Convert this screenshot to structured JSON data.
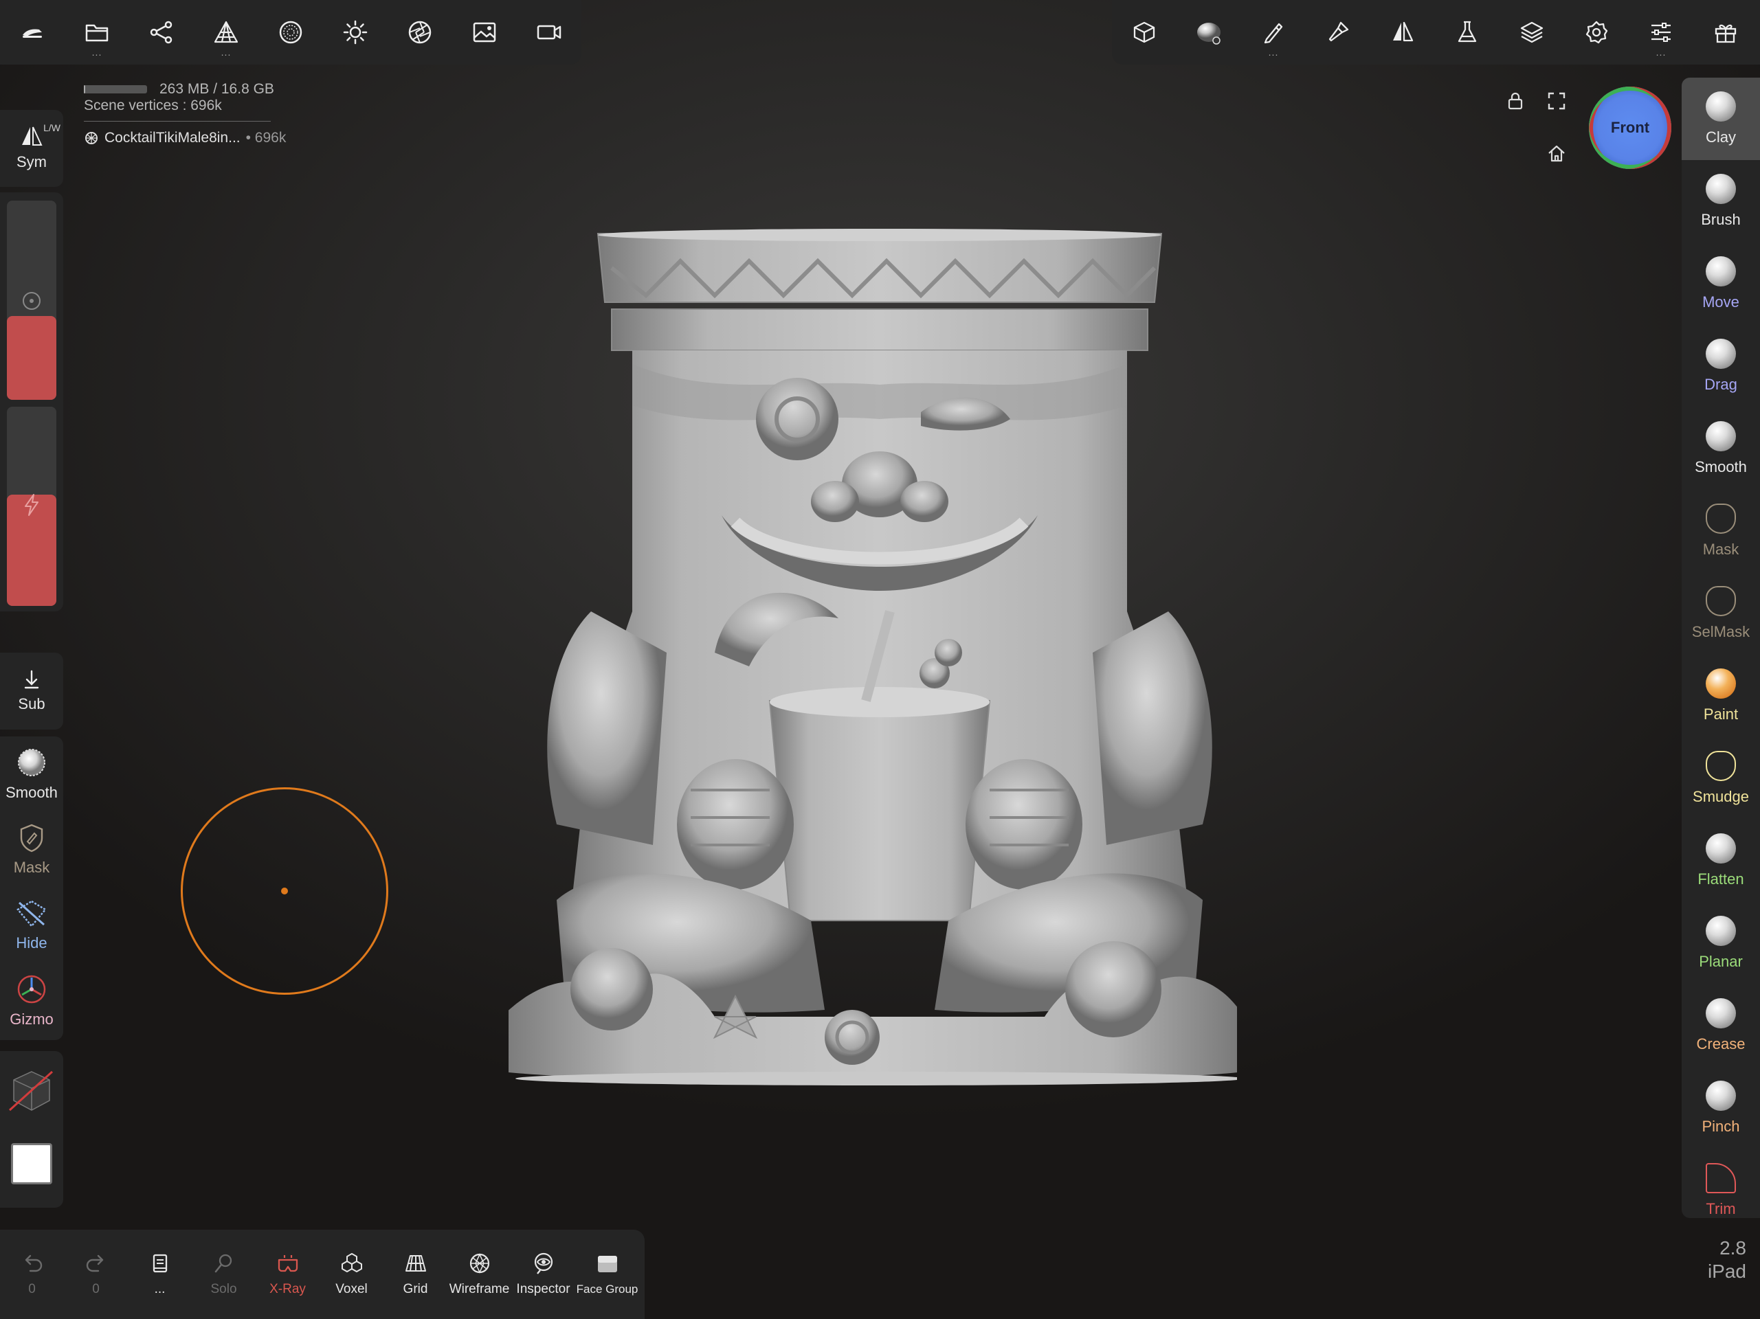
{
  "top_left_toolbar": [
    {
      "name": "app-menu-icon",
      "dots": ""
    },
    {
      "name": "folder-icon",
      "dots": "..."
    },
    {
      "name": "scene-graph-icon",
      "dots": ""
    },
    {
      "name": "topology-icon",
      "dots": "..."
    },
    {
      "name": "material-sphere-icon",
      "dots": ""
    },
    {
      "name": "light-sun-icon",
      "dots": ""
    },
    {
      "name": "camera-aperture-icon",
      "dots": ""
    },
    {
      "name": "image-icon",
      "dots": ""
    },
    {
      "name": "video-camera-icon",
      "dots": ""
    }
  ],
  "top_right_toolbar": [
    {
      "name": "scene-cube-icon",
      "dots": ""
    },
    {
      "name": "material-ball-icon",
      "dots": ""
    },
    {
      "name": "stroke-pen-icon",
      "dots": "..."
    },
    {
      "name": "painting-brush-icon",
      "dots": ""
    },
    {
      "name": "symmetry-icon",
      "dots": ""
    },
    {
      "name": "flask-icon",
      "dots": ""
    },
    {
      "name": "layers-icon",
      "dots": ""
    },
    {
      "name": "settings-gear-icon",
      "dots": ""
    },
    {
      "name": "sliders-icon",
      "dots": "..."
    },
    {
      "name": "gift-icon",
      "dots": ""
    }
  ],
  "stats": {
    "memory": "263 MB / 16.8 GB",
    "memory_fraction": 0.016,
    "scene_vertices": "Scene vertices : 696k",
    "object_name": "CocktailTikiMale8in...",
    "object_meta": "• 696k"
  },
  "view_cube": {
    "label": "Front"
  },
  "left_panel": {
    "sym": {
      "label": "Sym",
      "badge": "L/W"
    },
    "radius_fraction": 0.42,
    "intensity_fraction": 0.56,
    "sub": {
      "label": "Sub"
    },
    "tools": [
      {
        "label": "Smooth",
        "color": "#e8e8e8"
      },
      {
        "label": "Mask",
        "color": "#a89a86"
      },
      {
        "label": "Hide",
        "color": "#8fb6ec"
      },
      {
        "label": "Gizmo",
        "color": "#e8b5c9"
      }
    ]
  },
  "right_tools": [
    {
      "label": "Clay",
      "color": "#e8e8e8",
      "active": true
    },
    {
      "label": "Brush",
      "color": "#e8e8e8"
    },
    {
      "label": "Move",
      "color": "#a6a6f5"
    },
    {
      "label": "Drag",
      "color": "#a6a6f5"
    },
    {
      "label": "Smooth",
      "color": "#e8e8e8"
    },
    {
      "label": "Mask",
      "color": "#9a8e7a"
    },
    {
      "label": "SelMask",
      "color": "#9a8e7a"
    },
    {
      "label": "Paint",
      "color": "#f0e39a"
    },
    {
      "label": "Smudge",
      "color": "#f0e39a"
    },
    {
      "label": "Flatten",
      "color": "#9bdc7a"
    },
    {
      "label": "Planar",
      "color": "#9bdc7a"
    },
    {
      "label": "Crease",
      "color": "#f2b27a"
    },
    {
      "label": "Pinch",
      "color": "#f2b27a"
    },
    {
      "label": "Trim",
      "color": "#e05858"
    }
  ],
  "bottom_bar": [
    {
      "name": "undo-icon",
      "label": "0",
      "color": "#6b6b6b"
    },
    {
      "name": "redo-icon",
      "label": "0",
      "color": "#6b6b6b"
    },
    {
      "name": "history-icon",
      "label": "...",
      "color": "#e6e6e6"
    },
    {
      "name": "solo-icon",
      "label": "Solo",
      "color": "#6b6b6b"
    },
    {
      "name": "xray-icon",
      "label": "X-Ray",
      "color": "#d9574f"
    },
    {
      "name": "voxel-icon",
      "label": "Voxel",
      "color": "#e6e6e6"
    },
    {
      "name": "grid-icon",
      "label": "Grid",
      "color": "#e6e6e6"
    },
    {
      "name": "wireframe-icon",
      "label": "Wireframe",
      "color": "#e6e6e6"
    },
    {
      "name": "inspector-icon",
      "label": "Inspector",
      "color": "#e6e6e6"
    },
    {
      "name": "face-group-icon",
      "label": "Face Group",
      "color": "#e6e6e6"
    }
  ],
  "version": {
    "number": "2.8",
    "device": "iPad"
  }
}
